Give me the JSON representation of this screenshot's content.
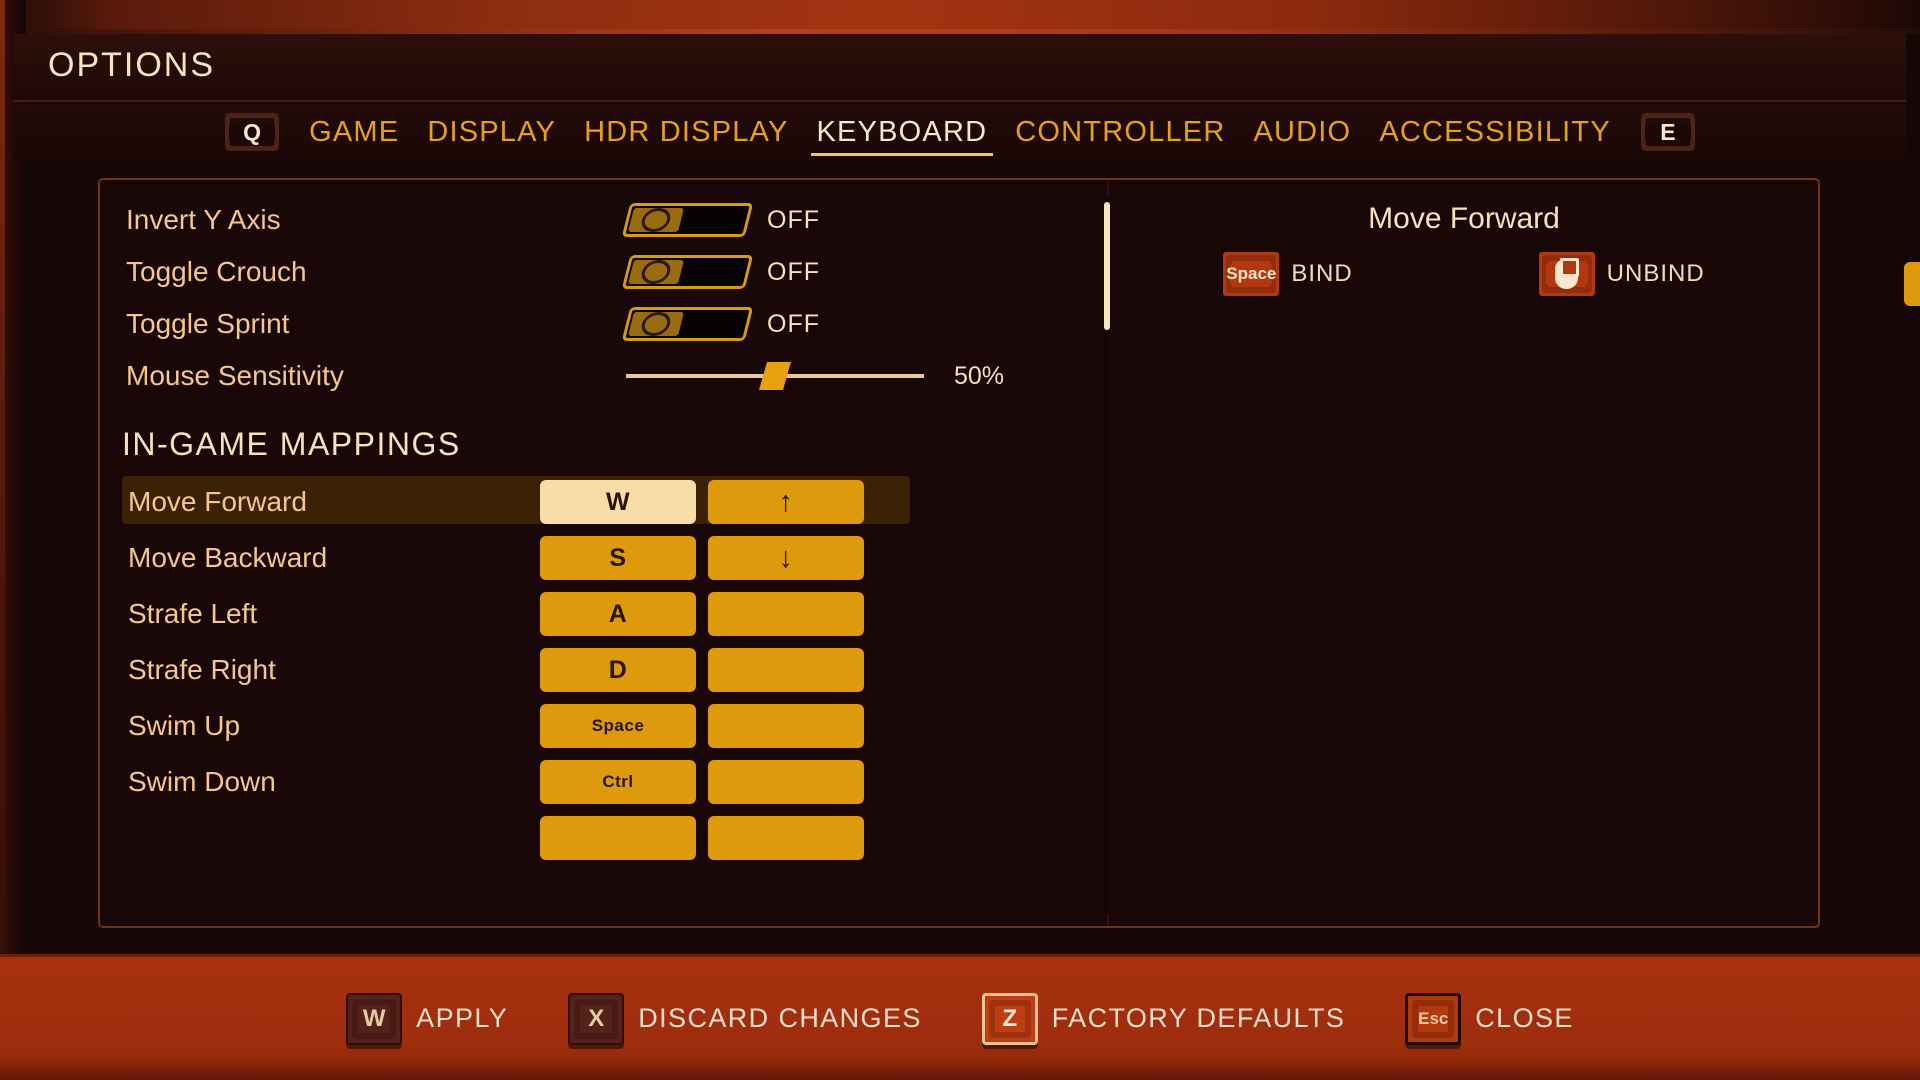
{
  "header": {
    "title": "OPTIONS"
  },
  "tabs": {
    "left_bumper": "Q",
    "right_bumper": "E",
    "items": [
      {
        "label": "GAME",
        "active": false
      },
      {
        "label": "DISPLAY",
        "active": false
      },
      {
        "label": "HDR DISPLAY",
        "active": false
      },
      {
        "label": "KEYBOARD",
        "active": true
      },
      {
        "label": "CONTROLLER",
        "active": false
      },
      {
        "label": "AUDIO",
        "active": false
      },
      {
        "label": "ACCESSIBILITY",
        "active": false
      }
    ]
  },
  "settings": [
    {
      "label": "Invert Y Axis",
      "type": "toggle",
      "value": "OFF"
    },
    {
      "label": "Toggle Crouch",
      "type": "toggle",
      "value": "OFF"
    },
    {
      "label": "Toggle Sprint",
      "type": "toggle",
      "value": "OFF"
    },
    {
      "label": "Mouse Sensitivity",
      "type": "slider",
      "value": "50%",
      "percent": 50
    }
  ],
  "mappings": {
    "section_title": "IN-GAME MAPPINGS",
    "rows": [
      {
        "label": "Move Forward",
        "primary": "W",
        "secondary": "↑",
        "selected": true
      },
      {
        "label": "Move Backward",
        "primary": "S",
        "secondary": "↓",
        "selected": false
      },
      {
        "label": "Strafe Left",
        "primary": "A",
        "secondary": "",
        "selected": false
      },
      {
        "label": "Strafe Right",
        "primary": "D",
        "secondary": "",
        "selected": false
      },
      {
        "label": "Swim Up",
        "primary": "Space",
        "secondary": "",
        "selected": false
      },
      {
        "label": "Swim Down",
        "primary": "Ctrl",
        "secondary": "",
        "selected": false
      },
      {
        "label": "",
        "primary": "",
        "secondary": "",
        "selected": false
      }
    ]
  },
  "detail": {
    "title": "Move Forward",
    "prompts": [
      {
        "key": "Space",
        "icon": "space-key-icon",
        "label": "BIND"
      },
      {
        "key": "",
        "icon": "mouse-icon",
        "label": "UNBIND"
      }
    ]
  },
  "footer": {
    "actions": [
      {
        "key": "W",
        "label": "APPLY",
        "highlight": false
      },
      {
        "key": "X",
        "label": "DISCARD CHANGES",
        "highlight": false
      },
      {
        "key": "Z",
        "label": "FACTORY DEFAULTS",
        "highlight": true
      },
      {
        "key": "Esc",
        "label": "CLOSE",
        "highlight": false
      }
    ]
  },
  "colors": {
    "accent_gold": "#dd9a0c",
    "accent_cream": "#f9dda7",
    "tab_gold": "#e6a01c",
    "footer_red": "#a8300f",
    "prompt_red": "#b3380f",
    "selected_row": "#3c2205"
  }
}
